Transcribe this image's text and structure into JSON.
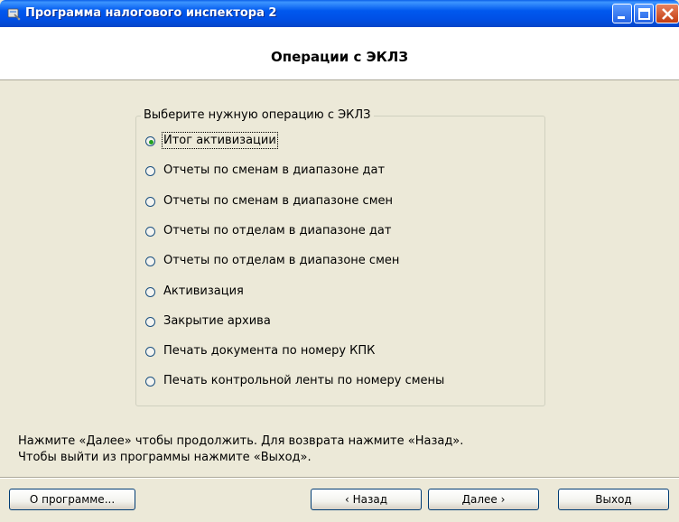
{
  "window": {
    "title": "Программа налогового инспектора 2",
    "icon": "app-icon"
  },
  "header": {
    "title": "Операции с ЭКЛЗ"
  },
  "operations": {
    "legend": "Выберите нужную операцию с ЭКЛЗ",
    "selected_index": 0,
    "options": [
      "Итог активизации",
      "Отчеты по сменам в диапазоне дат",
      "Отчеты по сменам в диапазоне смен",
      "Отчеты по отделам в диапазоне дат",
      "Отчеты по отделам в диапазоне смен",
      "Активизация",
      "Закрытие архива",
      "Печать документа по номеру КПК",
      "Печать контрольной ленты по номеру смены"
    ]
  },
  "instructions": {
    "line1": "Нажмите «Далее» чтобы продолжить. Для возврата нажмите «Назад».",
    "line2": "Чтобы выйти из программы нажмите «Выход»."
  },
  "buttons": {
    "about": "О программе...",
    "back": "‹ Назад",
    "next": "Далее ›",
    "exit": "Выход"
  },
  "colors": {
    "titlebar": "#0058EE",
    "dialog_bg": "#ECE9D8",
    "header_bg": "#FFFFFF",
    "radio_selected": "#21A121"
  }
}
